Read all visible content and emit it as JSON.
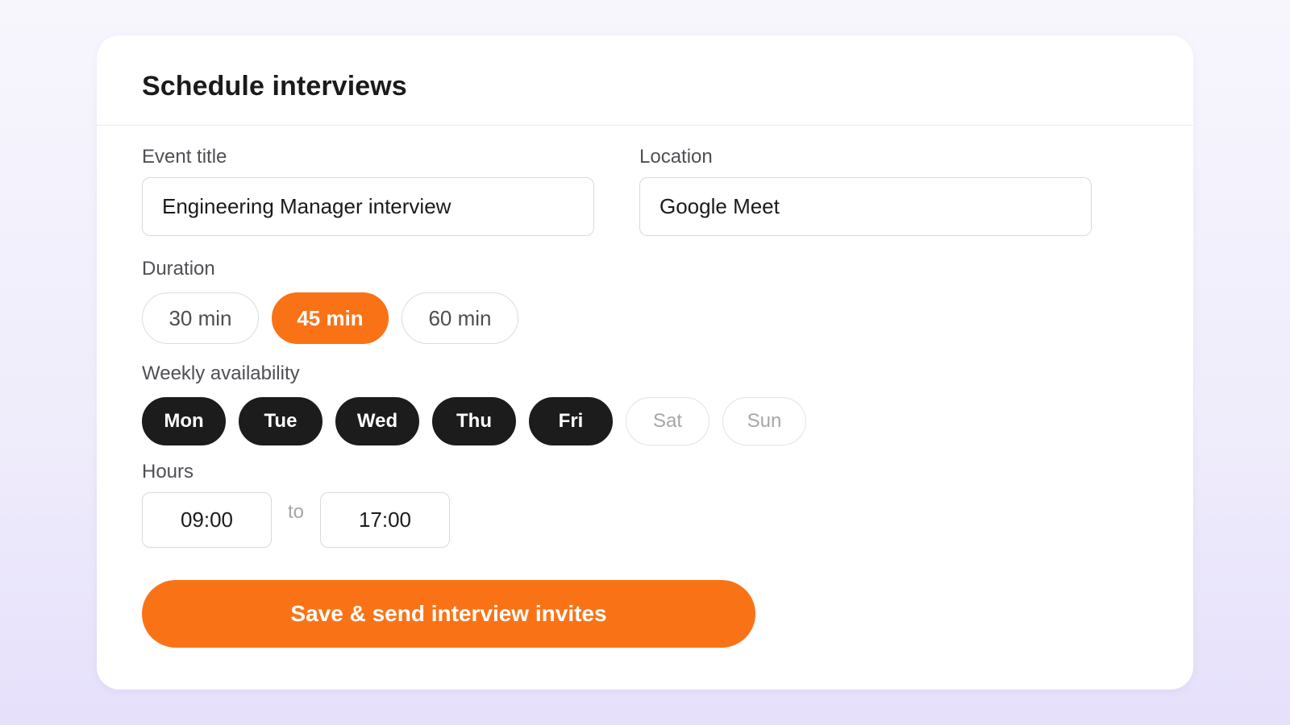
{
  "form": {
    "title": "Schedule interviews",
    "event_title": {
      "label": "Event title",
      "value": "Engineering Manager interview"
    },
    "location": {
      "label": "Location",
      "value": "Google Meet"
    },
    "duration": {
      "label": "Duration",
      "options": [
        {
          "label": "30 min",
          "selected": false
        },
        {
          "label": "45 min",
          "selected": true
        },
        {
          "label": "60 min",
          "selected": false
        }
      ]
    },
    "availability": {
      "label": "Weekly availability",
      "days": [
        {
          "label": "Mon",
          "selected": true
        },
        {
          "label": "Tue",
          "selected": true
        },
        {
          "label": "Wed",
          "selected": true
        },
        {
          "label": "Thu",
          "selected": true
        },
        {
          "label": "Fri",
          "selected": true
        },
        {
          "label": "Sat",
          "selected": false
        },
        {
          "label": "Sun",
          "selected": false
        }
      ]
    },
    "hours": {
      "label": "Hours",
      "start": "09:00",
      "separator": "to",
      "end": "17:00"
    },
    "submit_label": "Save & send interview invites"
  },
  "colors": {
    "accent": "#f97316",
    "day_selected": "#1c1c1d",
    "card_bg": "#ffffff"
  }
}
